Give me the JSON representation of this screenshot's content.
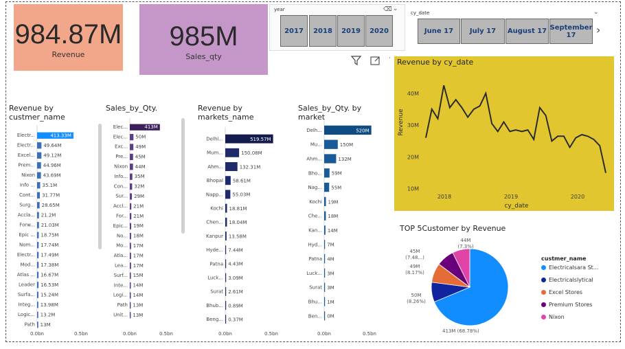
{
  "cards": {
    "revenue": {
      "value": "984.87M",
      "label": "Revenue",
      "color": "#f2a68a"
    },
    "sales_qty": {
      "value": "985M",
      "label": "Sales_qty",
      "color": "#c597c9"
    }
  },
  "year_slicer": {
    "label": "year",
    "options": [
      "2017",
      "2018",
      "2019",
      "2020"
    ]
  },
  "date_slicer": {
    "label": "cy_date",
    "options": [
      "June 17",
      "July 17",
      "August 17",
      "September 17"
    ]
  },
  "chart_data": [
    {
      "type": "bar",
      "title": "Revenue by custmer_name",
      "orientation": "horizontal",
      "categories": [
        "Electr...",
        "Electr...",
        "Excel...",
        "Prem...",
        "Nixon",
        "Info ...",
        "Cont...",
        "Surg...",
        "Accla...",
        "Forw...",
        "Epic ...",
        "Nom...",
        "Electr...",
        "Mod...",
        "Atlas ...",
        "Leader",
        "Surfa...",
        "Integ...",
        "Logic...",
        "Path"
      ],
      "values": [
        413.33,
        49.64,
        49.12,
        44.96,
        43.69,
        35.1,
        31.77,
        28.65,
        21.2,
        21.03,
        18.75,
        17.74,
        17.49,
        17.38,
        16.67,
        16.53,
        15.24,
        13.98,
        13.2,
        13
      ],
      "labels": [
        "413.33M",
        "49.64M",
        "49.12M",
        "44.96M",
        "43.69M",
        "35.1M",
        "31.77M",
        "28.65M",
        "21.2M",
        "21.03M",
        "18.75M",
        "17.74M",
        "17.49M",
        "17.38M",
        "16.67M",
        "16.53M",
        "15.24M",
        "13.98M",
        "13.2M",
        "13M"
      ],
      "highlight_color": "#118dff",
      "color": "#3a6fb5",
      "xticks": [
        "0.0bn",
        "0.5bn"
      ]
    },
    {
      "type": "bar",
      "title": "Sales_by_Qty.",
      "orientation": "horizontal",
      "categories": [
        "Elec...",
        "Elec...",
        "Exc...",
        "Pre...",
        "Nixon",
        "Info...",
        "Con...",
        "Sur...",
        "Accl...",
        "For...",
        "Epic...",
        "No...",
        "Mo...",
        "Atla...",
        "Lea...",
        "Surf...",
        "Inte...",
        "Logi...",
        "Path",
        "Unit..."
      ],
      "values": [
        413,
        50,
        49,
        45,
        44,
        35,
        32,
        29,
        21,
        21,
        19,
        18,
        17,
        17,
        17,
        15,
        14,
        14,
        13,
        13
      ],
      "labels": [
        "413M",
        "50M",
        "49M",
        "45M",
        "44M",
        "35M",
        "32M",
        "29M",
        "21M",
        "21M",
        "19M",
        "18M",
        "17M",
        "17M",
        "17M",
        "15M",
        "14M",
        "14M",
        "13M",
        "13M"
      ],
      "highlight_color": "#3a1f5c",
      "color": "#5a3d85",
      "xticks": [
        "0.0bn",
        "0.5bn"
      ]
    },
    {
      "type": "bar",
      "title": "Revenue by markets_name",
      "orientation": "horizontal",
      "categories": [
        "Delhi...",
        "Mum...",
        "Ahm...",
        "Bhopal",
        "Napp...",
        "Kochi",
        "Chen...",
        "Kanpur",
        "Hyde...",
        "Patna",
        "Luck...",
        "Surat",
        "Bhub...",
        "Beng..."
      ],
      "values": [
        519.57,
        150.08,
        132.31,
        58.61,
        55.03,
        18.81,
        18.04,
        13.58,
        7.44,
        4.43,
        3.09,
        2.61,
        0.89,
        0.37
      ],
      "labels": [
        "519.57M",
        "150.08M",
        "132.31M",
        "58.61M",
        "55.03M",
        "18.81M",
        "18.04M",
        "13.58M",
        "7.44M",
        "4.43M",
        "3.09M",
        "2.61M",
        "0.89M",
        "0.37M"
      ],
      "highlight_color": "#141b4d",
      "color": "#1f2a6b",
      "xticks": [
        "0.0bn",
        "0.5bn"
      ]
    },
    {
      "type": "bar",
      "title": "Sales_by_Qty. by market",
      "orientation": "horizontal",
      "categories": [
        "Delh...",
        "Mu...",
        "Ahm...",
        "Bho...",
        "Nag...",
        "Kochi",
        "Che...",
        "Kan...",
        "Hyd...",
        "Patna",
        "Luck...",
        "Surat",
        "Bhu...",
        "Ben..."
      ],
      "values": [
        520,
        150,
        132,
        59,
        55,
        19,
        18,
        14,
        7,
        4,
        3,
        3,
        1,
        0
      ],
      "labels": [
        "520M",
        "150M",
        "132M",
        "59M",
        "55M",
        "19M",
        "18M",
        "14M",
        "7M",
        "4M",
        "3M",
        "3M",
        "1M",
        "0M"
      ],
      "highlight_color": "#0f4c81",
      "color": "#1a5a96",
      "xticks": [
        "0.0bn",
        "0.5bn"
      ]
    },
    {
      "type": "line",
      "title": "Revenue by cy_date",
      "xlabel": "cy_date",
      "ylabel": "Revenue",
      "x_ticks": [
        "2018",
        "2019",
        "2020"
      ],
      "y_ticks": [
        "10M",
        "20M",
        "30M",
        "40M"
      ],
      "ylim": [
        8,
        46
      ],
      "x": [
        "2017-10",
        "2017-11",
        "2017-12",
        "2018-01",
        "2018-02",
        "2018-03",
        "2018-04",
        "2018-05",
        "2018-06",
        "2018-07",
        "2018-08",
        "2018-09",
        "2018-10",
        "2018-11",
        "2018-12",
        "2019-01",
        "2019-02",
        "2019-03",
        "2019-04",
        "2019-05",
        "2019-06",
        "2019-07",
        "2019-08",
        "2019-09",
        "2019-10",
        "2019-11",
        "2019-12",
        "2020-01",
        "2020-02",
        "2020-03",
        "2020-04",
        "2020-05",
        "2020-06"
      ],
      "values": [
        26,
        35,
        32,
        42.5,
        35.5,
        38,
        35.5,
        32.5,
        35,
        36,
        40,
        30.5,
        28,
        31,
        28,
        28.5,
        28,
        28.5,
        25.5,
        35.5,
        33,
        25,
        26.5,
        26.5,
        23,
        26,
        27,
        26.5,
        25.5,
        23.5,
        15
      ],
      "background": "#e2c62f",
      "line_color": "#2b2b2b"
    },
    {
      "type": "pie",
      "title": "TOP 5Customer by Revenue",
      "legend_title": "custmer_name",
      "categories": [
        "Electricalsara St...",
        "Electricalslytical",
        "Excel Stores",
        "Premium Stores",
        "Nixon"
      ],
      "values": [
        413,
        50,
        49,
        45,
        44
      ],
      "slice_labels": [
        "413M (68.78%)",
        "50M (8.26%)",
        "49M (8.17%)",
        "45M (7.48...)",
        "44M (7.3%)"
      ],
      "colors": [
        "#118dff",
        "#12239e",
        "#e66c37",
        "#6b007b",
        "#e044a7"
      ],
      "legend_position": "right"
    }
  ]
}
